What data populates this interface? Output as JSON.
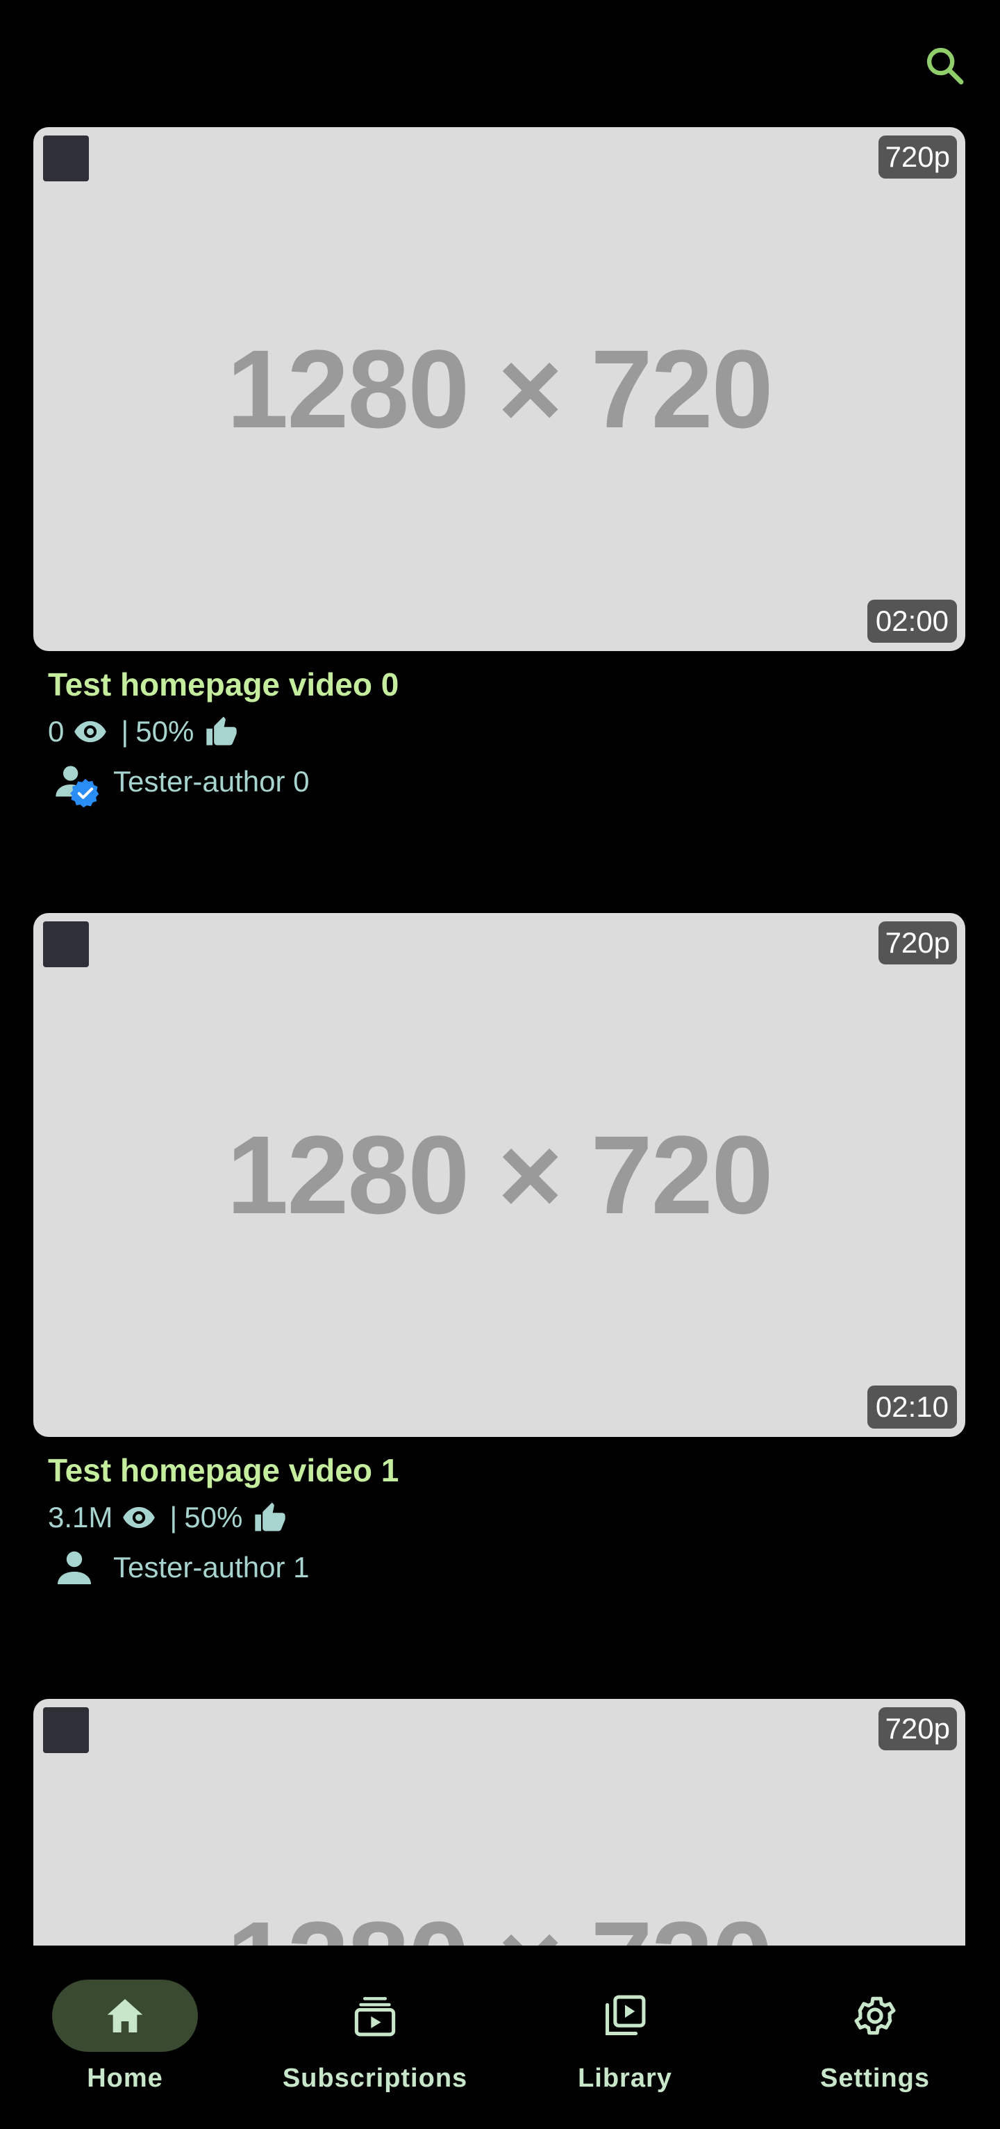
{
  "colors": {
    "background": "#000000",
    "accent": "#c5ed9e",
    "secondary_text": "#a8d4d0",
    "thumbnail_bg": "#dcdcdc",
    "badge_bg": "#555555",
    "verified": "#2a8cf5",
    "nav_active_bg": "#3a4a30"
  },
  "header": {
    "search_icon": "search-icon"
  },
  "videos": [
    {
      "thumbnail_text": "1280 × 720",
      "quality": "720p",
      "duration": "02:00",
      "title": "Test homepage video 0",
      "views": "0",
      "separator": "|",
      "likes_ratio": "50%",
      "author": "Tester-author 0",
      "author_verified": true
    },
    {
      "thumbnail_text": "1280 × 720",
      "quality": "720p",
      "duration": "02:10",
      "title": "Test homepage video 1",
      "views": "3.1M",
      "separator": "|",
      "likes_ratio": "50%",
      "author": "Tester-author 1",
      "author_verified": false
    },
    {
      "thumbnail_text": "1280 × 720",
      "quality": "720p"
    }
  ],
  "bottom_nav": [
    {
      "label": "Home",
      "icon": "home-icon",
      "active": true
    },
    {
      "label": "Subscriptions",
      "icon": "subscriptions-icon",
      "active": false
    },
    {
      "label": "Library",
      "icon": "library-icon",
      "active": false
    },
    {
      "label": "Settings",
      "icon": "settings-icon",
      "active": false
    }
  ]
}
